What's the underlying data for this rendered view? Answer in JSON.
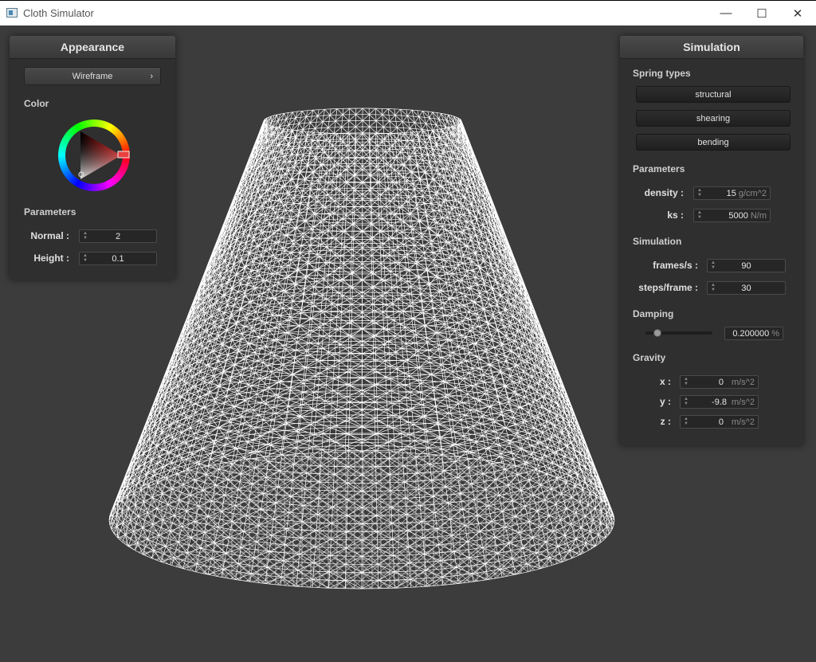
{
  "window": {
    "title": "Cloth Simulator",
    "minimize_icon": "—",
    "maximize_icon": "☐",
    "close_icon": "✕"
  },
  "appearance": {
    "header": "Appearance",
    "mode": "Wireframe",
    "mode_chevron": "›",
    "color_section": "Color",
    "params_section": "Parameters",
    "normal_label": "Normal :",
    "normal_value": "2",
    "height_label": "Height :",
    "height_value": "0.1"
  },
  "simulation": {
    "header": "Simulation",
    "spring_types_label": "Spring types",
    "structural": "structural",
    "shearing": "shearing",
    "bending": "bending",
    "params_section": "Parameters",
    "density_label": "density :",
    "density_value": "15",
    "density_unit": "g/cm^2",
    "ks_label": "ks :",
    "ks_value": "5000",
    "ks_unit": "N/m",
    "sim_section": "Simulation",
    "fps_label": "frames/s :",
    "fps_value": "90",
    "steps_label": "steps/frame :",
    "steps_value": "30",
    "damping_section": "Damping",
    "damping_value": "0.200000",
    "damping_unit": "%",
    "damping_fraction": 0.2,
    "gravity_section": "Gravity",
    "gx_label": "x :",
    "gx_value": "0",
    "gy_label": "y :",
    "gy_value": "-9.8",
    "gz_label": "z :",
    "gz_value": "0",
    "g_unit": "m/s^2"
  },
  "colors": {
    "background": "#3c3c3c",
    "mesh": "#ffffff",
    "panel": "#2f2f2f"
  }
}
